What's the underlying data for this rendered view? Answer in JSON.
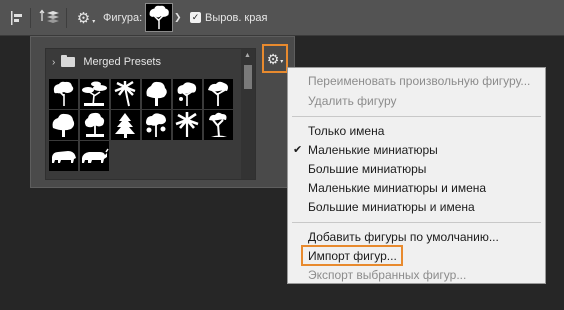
{
  "optbar": {
    "figure_label": "Фигура:",
    "antialias_label": "Выров. края",
    "antialias_checked": "✓",
    "colors": {
      "bg": "#535353",
      "accent": "#e88a2e"
    },
    "icons": [
      "align-icon",
      "stack-arrange-icon",
      "gear-icon",
      "chevron-down-icon"
    ]
  },
  "picker": {
    "folder_label": "Merged Presets",
    "shapes": [
      "tree-1",
      "tree-2",
      "palm-1",
      "tree-3",
      "tree-4",
      "tree-5",
      "tree-6",
      "tree-7",
      "pine",
      "tree-8",
      "palm-2",
      "tree-9",
      "bear",
      "rhino"
    ]
  },
  "menu": {
    "items": [
      {
        "label": "Переименовать произвольную фигуру...",
        "disabled": true
      },
      {
        "label": "Удалить фигуру",
        "disabled": true
      },
      {
        "label": "Только имена",
        "disabled": false
      },
      {
        "label": "Маленькие миниатюры",
        "disabled": false,
        "checked": "✔"
      },
      {
        "label": "Большие миниатюры",
        "disabled": false
      },
      {
        "label": "Маленькие миниатюры и имена",
        "disabled": false
      },
      {
        "label": "Большие миниатюры и имена",
        "disabled": false
      },
      {
        "label": "Добавить фигуры по умолчанию...",
        "disabled": false
      },
      {
        "label": "Импорт фигур...",
        "disabled": false
      },
      {
        "label": "Экспорт выбранных фигур...",
        "disabled": true
      }
    ]
  }
}
